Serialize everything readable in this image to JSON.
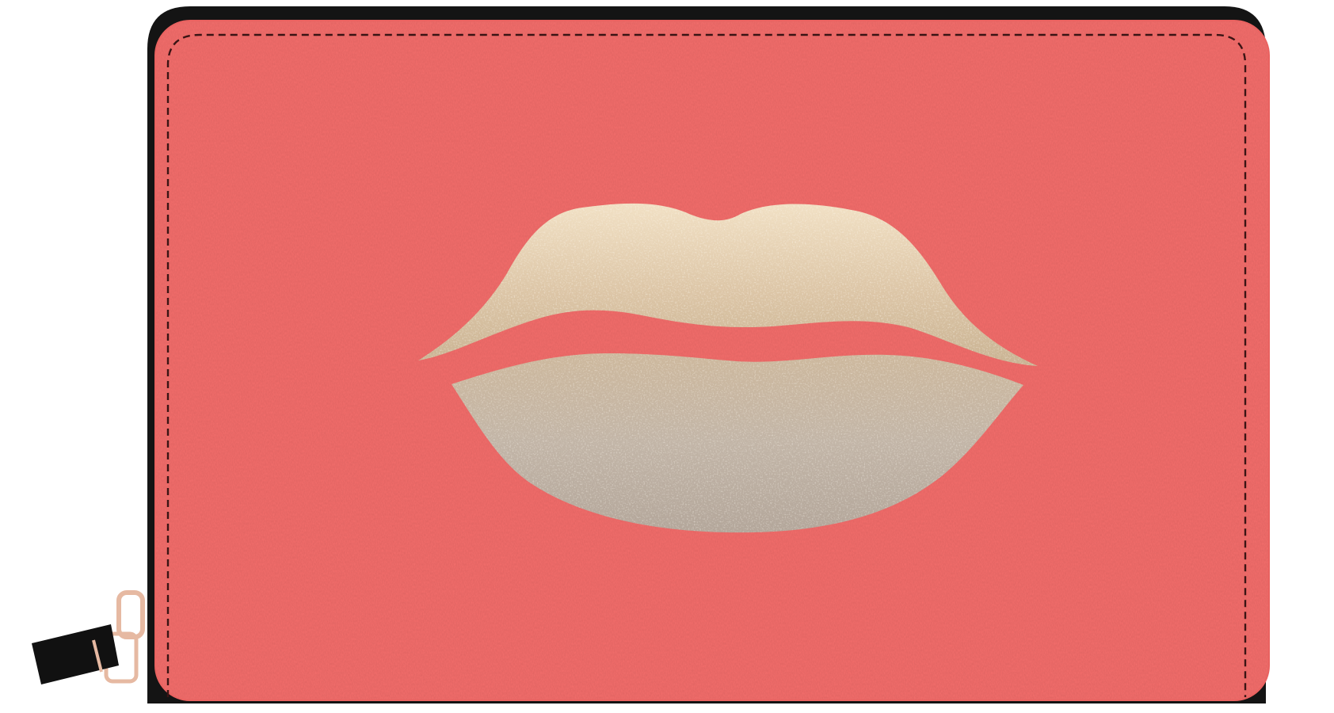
{
  "product": {
    "kind": "zip-around wallet",
    "motif": "glitter lips"
  },
  "colors": {
    "background": "#ffffff",
    "wallet_body": "#f66e6c",
    "wallet_body_shade": "#ee6563",
    "zipper_tape": "#141414",
    "stitching": "#3a1414",
    "glitter_light": "#efdcbf",
    "glitter_mid": "#d7c2a6",
    "glitter_dark": "#b9ab9e",
    "zipper_pull_metal": "#e6b9a2",
    "zipper_tab": "#111111"
  },
  "icons": {
    "motif_icon": "lips-icon",
    "zipper_icon": "zipper-pull-icon"
  }
}
